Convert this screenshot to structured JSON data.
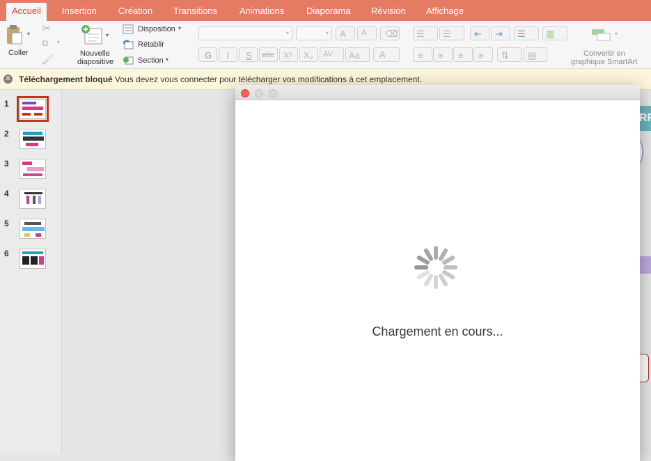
{
  "tabs": [
    "Accueil",
    "Insertion",
    "Création",
    "Transitions",
    "Animations",
    "Diaporama",
    "Révision",
    "Affichage"
  ],
  "ribbon": {
    "paste_label": "Coller",
    "new_slide_label_1": "Nouvelle",
    "new_slide_label_2": "diapositive",
    "layout_label": "Disposition",
    "reset_label": "Rétablir",
    "section_label": "Section",
    "bold": "G",
    "italic": "I",
    "underline": "S",
    "strike": "abc",
    "superscript": "X²",
    "subscript": "X₂",
    "spacing": "AV",
    "font_color": "A",
    "grow": "A",
    "shrink": "A",
    "change_case": "Aa",
    "smartart_label_1": "Convertir en",
    "smartart_label_2": "graphique SmartArt"
  },
  "notification": {
    "title": "Téléchargement bloqué",
    "message": "Vous devez vous connecter pour télécharger vos modifications à cet emplacement."
  },
  "slides": [
    "1",
    "2",
    "3",
    "4",
    "5",
    "6"
  ],
  "selected_slide": "1",
  "canvas_deco_text": "RR",
  "dialog": {
    "loading_text": "Chargement en cours..."
  },
  "colors": {
    "tab_bar": "#e57b63",
    "accent": "#d24726",
    "selection": "#c2341a",
    "notification_bg": "#fdf6dc"
  }
}
